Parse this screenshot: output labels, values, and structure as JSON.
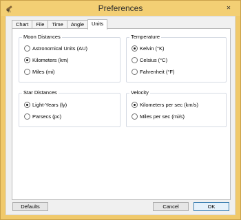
{
  "window": {
    "title": "Preferences",
    "close_symbol": "✕",
    "icons": {
      "app": "telescope-icon",
      "close": "close-icon"
    },
    "colors": {
      "frame": "#f0c96b",
      "titlebar": "#f3cf74",
      "client": "#f0f0f0",
      "panel": "#ffffff"
    }
  },
  "tabs": [
    {
      "label": "Chart"
    },
    {
      "label": "File"
    },
    {
      "label": "Time"
    },
    {
      "label": "Angle"
    },
    {
      "label": "Units",
      "active": true
    }
  ],
  "groups": {
    "moon_distances": {
      "title": "Moon Distances",
      "options": [
        {
          "label": "Astronomical Units (AU)",
          "selected": false
        },
        {
          "label": "Kilometers (km)",
          "selected": true
        },
        {
          "label": "Miles (mi)",
          "selected": false
        }
      ]
    },
    "temperature": {
      "title": "Temperature",
      "options": [
        {
          "label": "Kelvin (°K)",
          "selected": true
        },
        {
          "label": "Celsius (°C)",
          "selected": false
        },
        {
          "label": "Fahrenheit (°F)",
          "selected": false
        }
      ]
    },
    "star_distances": {
      "title": "Star Distances",
      "options": [
        {
          "label": "Light-Years (ly)",
          "selected": true
        },
        {
          "label": "Parsecs (pc)",
          "selected": false
        }
      ]
    },
    "velocity": {
      "title": "Velocity",
      "options": [
        {
          "label": "Kilometers per sec (km/s)",
          "selected": true
        },
        {
          "label": "Miles per sec (mi/s)",
          "selected": false
        }
      ]
    }
  },
  "buttons": {
    "defaults": "Defaults",
    "cancel": "Cancel",
    "ok": "OK"
  }
}
